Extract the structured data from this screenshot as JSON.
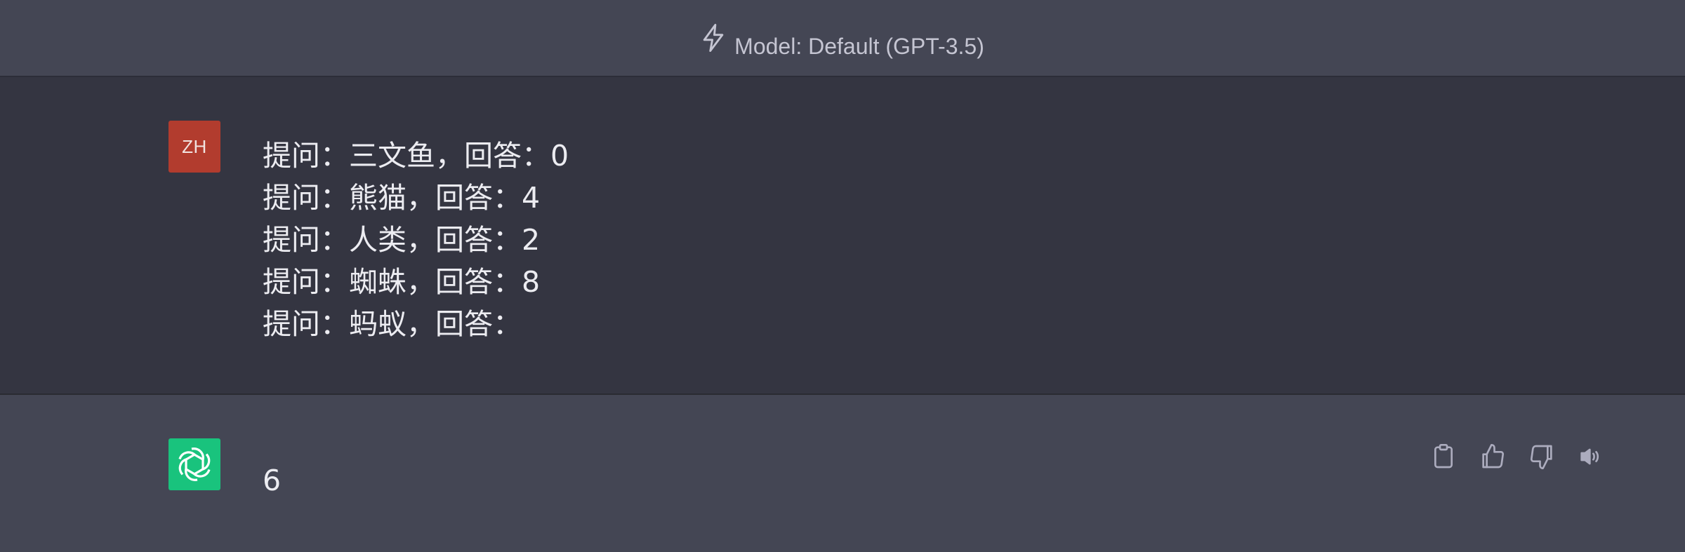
{
  "header": {
    "model_icon": "lightning-icon",
    "model_label": "Model: Default (GPT-3.5)"
  },
  "user_message": {
    "avatar_initials": "ZH",
    "avatar_color": "#b23c2e",
    "lines": [
      "提问：三文鱼，回答：0",
      "提问：熊猫，回答：4",
      "提问：人类，回答：2",
      "提问：蜘蛛，回答：8",
      "提问：蚂蚁，回答："
    ]
  },
  "assistant_message": {
    "avatar_icon": "openai-logo-icon",
    "avatar_color": "#19c37d",
    "text": "6",
    "actions": [
      "copy-icon",
      "thumbs-up-icon",
      "thumbs-down-icon",
      "speaker-icon"
    ]
  },
  "colors": {
    "page_bg": "#343541",
    "panel_bg": "#444654",
    "text": "#ececf1",
    "muted": "#c5c5d2"
  }
}
